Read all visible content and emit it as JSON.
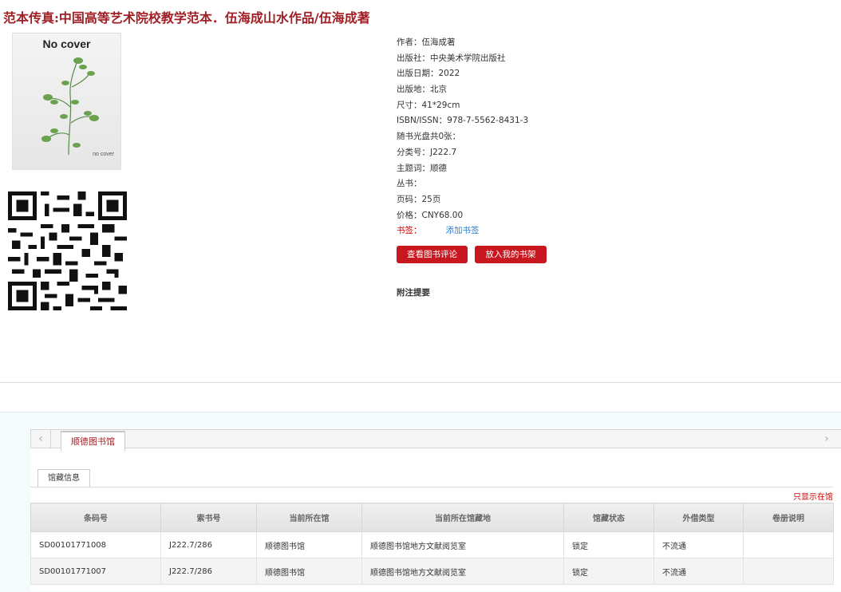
{
  "title": "范本传真:中国高等艺术院校教学范本．伍海成山水作品/伍海成著",
  "cover": {
    "title": "No cover",
    "footer": "no cover"
  },
  "details": [
    {
      "label": "作者：",
      "value": "伍海成著"
    },
    {
      "label": "出版社：",
      "value": "中央美术学院出版社"
    },
    {
      "label": "出版日期：",
      "value": "2022"
    },
    {
      "label": "出版地：",
      "value": "北京"
    },
    {
      "label": "尺寸：",
      "value": "41*29cm"
    },
    {
      "label": "ISBN/ISSN：",
      "value": "978-7-5562-8431-3"
    },
    {
      "label": "随书光盘共0张：",
      "value": ""
    },
    {
      "label": "分类号：",
      "value": "J222.7"
    },
    {
      "label": "主题词：",
      "value": "顺德"
    },
    {
      "label": "丛书：",
      "value": ""
    },
    {
      "label": "页码：",
      "value": "25页"
    },
    {
      "label": "价格：",
      "value": "CNY68.00"
    }
  ],
  "tags": {
    "label": "书签：",
    "add_label": "添加书签"
  },
  "buttons": {
    "review": "查看图书评论",
    "shelf": "放入我的书架"
  },
  "notes_heading": "附注提要",
  "holdings": {
    "arrow_left": "‹",
    "arrow_right": "›",
    "library_tab": "顺德图书馆",
    "sub_tab": "馆藏信息",
    "only_local": "只显示在馆",
    "columns": [
      "条码号",
      "索书号",
      "当前所在馆",
      "当前所在馆藏地",
      "馆藏状态",
      "外借类型",
      "卷册说明"
    ],
    "rows": [
      [
        "SD00101771008",
        "J222.7/286",
        "顺德图书馆",
        "顺德图书馆地方文献阅览室",
        "锁定",
        "不流通",
        ""
      ],
      [
        "SD00101771007",
        "J222.7/286",
        "顺德图书馆",
        "顺德图书馆地方文献阅览室",
        "锁定",
        "不流通",
        ""
      ]
    ]
  },
  "colors": {
    "accent": "#a01f24",
    "button": "#c8171e",
    "link": "#2a7fd4"
  }
}
